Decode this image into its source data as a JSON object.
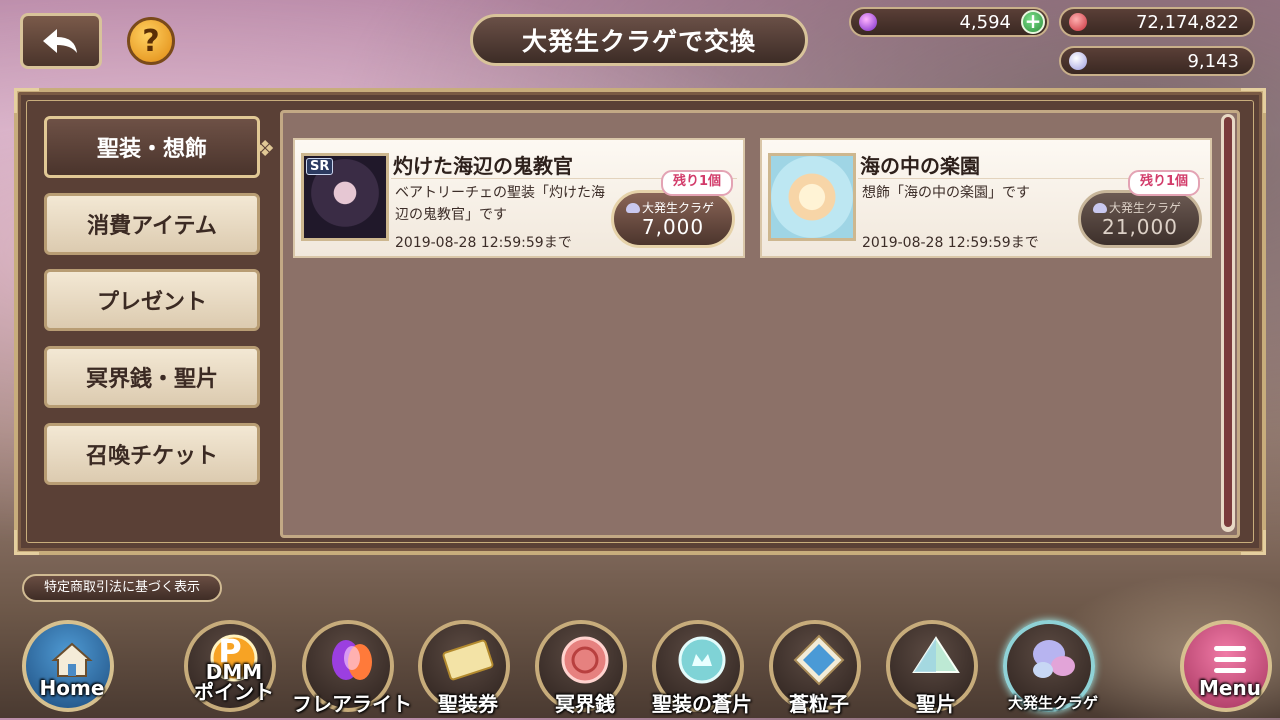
{
  "header": {
    "title": "大発生クラゲで交換",
    "help_symbol": "?",
    "back_icon": "back-arrow-icon"
  },
  "currencies": [
    {
      "name": "flare-crystal",
      "value": "4,594",
      "color": "#8a3fd0"
    },
    {
      "name": "coin",
      "value": "72,174,822",
      "color": "#e04a55"
    },
    {
      "name": "jellyfish",
      "value": "9,143",
      "color": "#c9c8ef"
    }
  ],
  "plus_symbol": "+",
  "tabs": [
    {
      "label": "聖装・想飾",
      "active": true
    },
    {
      "label": "消費アイテム",
      "active": false
    },
    {
      "label": "プレゼント",
      "active": false
    },
    {
      "label": "冥界銭・聖片",
      "active": false
    },
    {
      "label": "召喚チケット",
      "active": false
    }
  ],
  "items": [
    {
      "badge": "SR",
      "title": "灼けた海辺の鬼教官",
      "desc": "ベアトリーチェの聖装「灼けた海辺の鬼教官」です",
      "date": "2019-08-28 12:59:59まで",
      "remain": "残り1個",
      "currency": "大発生クラゲ",
      "price": "7,000",
      "enabled": true
    },
    {
      "badge": "",
      "title": "海の中の楽園",
      "desc": "想飾「海の中の楽園」です",
      "date": "2019-08-28 12:59:59まで",
      "remain": "残り1個",
      "currency": "大発生クラゲ",
      "price": "21,000",
      "enabled": false
    }
  ],
  "legal_button": "特定商取引法に基づく表示",
  "bottom_nav": [
    {
      "label": "Home",
      "icon": "home-icon"
    },
    {
      "label": "DMM\nポイント",
      "icon": "dmm-point-icon",
      "logo_text": "P"
    },
    {
      "label": "フレアライト",
      "icon": "flare-light-icon"
    },
    {
      "label": "聖装券",
      "icon": "seisou-ticket-icon"
    },
    {
      "label": "冥界銭",
      "icon": "meikai-coin-icon"
    },
    {
      "label": "聖装の蒼片",
      "icon": "blue-shard-icon"
    },
    {
      "label": "蒼粒子",
      "icon": "blue-particle-icon"
    },
    {
      "label": "聖片",
      "icon": "holy-shard-icon"
    },
    {
      "label": "大発生クラゲ",
      "icon": "jellyfish-icon"
    },
    {
      "label": "Menu",
      "icon": "menu-icon"
    }
  ]
}
